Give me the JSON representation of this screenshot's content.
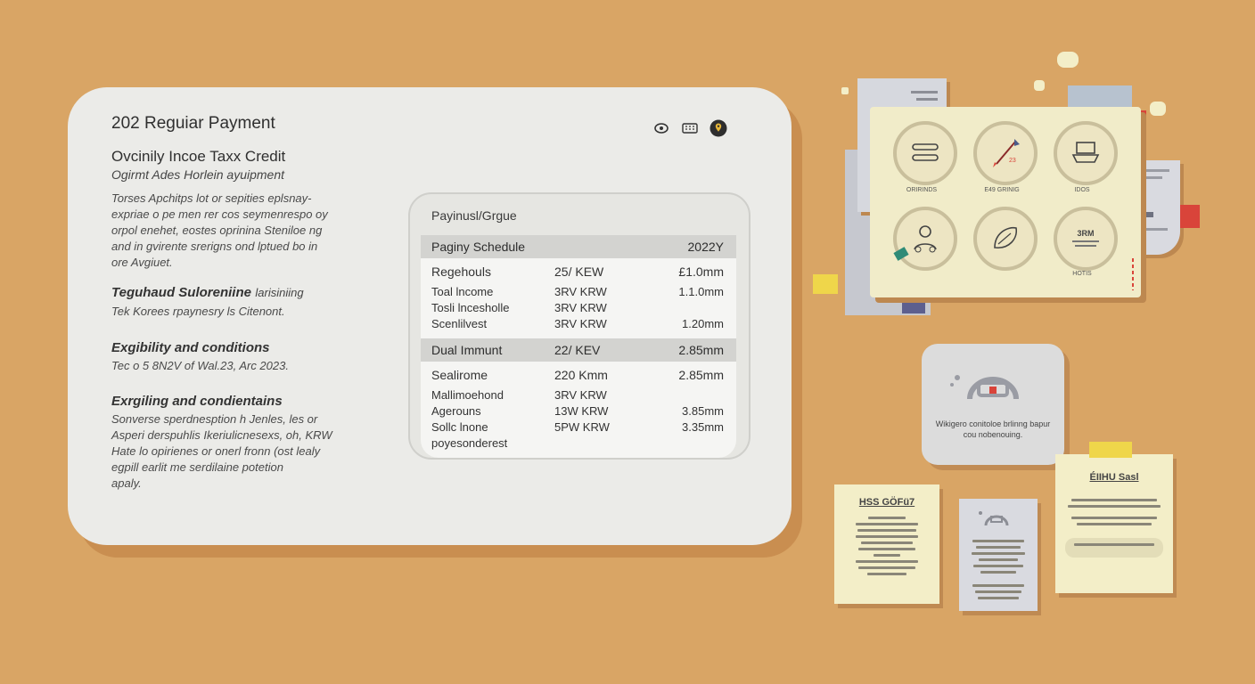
{
  "card": {
    "title": "202 Reguiar Payment",
    "section1": {
      "heading": "Ovcinily Incoe Taxx Credit",
      "subheading": "Ogirmt Ades Horlein ayuipment",
      "lines": [
        "Torses Apchitps lot or sepities eplsnay-",
        "expriae o pe men rer cos seymenrespo oy",
        "orpol enehet, eostes oprinina Steniloe ng",
        "and in gvirente srerigns ond lptued bo in",
        "ore Avgiuet."
      ]
    },
    "section2": {
      "heading": "Teguhaud Suloreniine",
      "heading_tail": "larisiniing",
      "line": "Tek Korees rpaynesry ls Citenont."
    },
    "section3": {
      "heading": "Exgibility and conditions",
      "line": "Tec o 5 8N2V of Wal.23, Arc 2023."
    },
    "section4": {
      "heading": "Exrgiling and condientains",
      "lines": [
        "Sonverse sperdnesption h Jenles, les or",
        "Asperi derspuhlis Ikeriulicnesexs, oh, KRW",
        "Hate lo opirienes or onerl fronn (ost lealy",
        "egpill earlit me serdilaine potetion",
        "apaly."
      ]
    }
  },
  "toolbar": {
    "icons": [
      "eye-icon",
      "keyboard-icon",
      "location-pin-icon"
    ],
    "accent": "#e6b638"
  },
  "panel": {
    "title": "Payinusl/Grgue",
    "header": {
      "label": "Paginy Schedule",
      "value": "2022Y"
    },
    "group1": {
      "rows": [
        {
          "name": "Regehouls",
          "amount": "25/ KEW",
          "value": "£1.0mm"
        },
        {
          "name": "Toal lncome",
          "amount": "3RV KRW",
          "value": "1.1.0mm"
        },
        {
          "name": "Tosli lncesholle",
          "amount": "3RV KRW",
          "value": ""
        },
        {
          "name": "Scenlilvest",
          "amount": "3RV KRW",
          "value": "1.20mm"
        }
      ]
    },
    "group2": {
      "header": {
        "name": "Dual Immunt",
        "amount": "22/ KEV",
        "value": "2.85mm"
      },
      "rows": [
        {
          "name": "Sealirome",
          "amount": "220 Kmm",
          "value": "2.85mm"
        },
        {
          "name": "Mallimoehond",
          "amount": "3RV KRW",
          "value": ""
        },
        {
          "name": "Agerouns",
          "amount": "13W KRW",
          "value": "3.85mm"
        },
        {
          "name": "Sollc lnone",
          "amount": "5PW KRW",
          "value": "3.35mm"
        },
        {
          "name": "poyesonderest",
          "amount": "",
          "value": ""
        }
      ]
    }
  },
  "collage": {
    "board_labels": [
      "ORIRINDS",
      "E49  GRINIG",
      "IDOS",
      "",
      "",
      "HOTIS"
    ],
    "circle_text": [
      "",
      "23",
      "",
      "",
      "",
      "3RM"
    ],
    "popup_text": "Wikigero conitoloe brlinng bapur cou nobenouing.",
    "note_left_title": "HSS GÖFü7",
    "note_right_title": "ÉIIHU Sasl"
  }
}
